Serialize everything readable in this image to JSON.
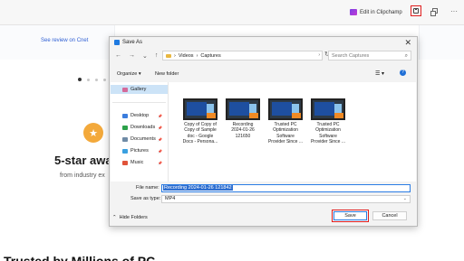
{
  "toolbar": {
    "edit_in_clipchamp": "Edit in Clipchamp",
    "more": "···"
  },
  "page": {
    "review_link": "See review on Cnet",
    "award_heading": "5-star awa",
    "award_sub": "from industry ex",
    "bottom_heading": "Trusted by Millions of PC"
  },
  "dialog": {
    "title": "Save As",
    "close": "✕",
    "nav": {
      "back": "←",
      "forward": "→",
      "down": "⌄",
      "up": "↑"
    },
    "address": {
      "path_1": "Videos",
      "sep": "›",
      "path_2": "Captures",
      "chev": "›"
    },
    "refresh": "↻",
    "search_placeholder": "Search Captures",
    "organize": "Organize ▾",
    "new_folder": "New folder",
    "view": "☰ ▾",
    "help": "?",
    "nav_items": [
      {
        "label": "Gallery",
        "icon": "gallery-icon",
        "color": "#d46a9a"
      },
      {
        "label": "Desktop",
        "icon": "desktop-icon",
        "color": "#3b7ddd"
      },
      {
        "label": "Downloads",
        "icon": "downloads-icon",
        "color": "#2ca14a"
      },
      {
        "label": "Documents",
        "icon": "documents-icon",
        "color": "#6f8ba6"
      },
      {
        "label": "Pictures",
        "icon": "pictures-icon",
        "color": "#3aa0e0"
      },
      {
        "label": "Music",
        "icon": "music-icon",
        "color": "#e0533a"
      }
    ],
    "files": [
      {
        "label": "Copy of Copy of\nCopy of Sample\ndoc - Google\nDocs - Persona..."
      },
      {
        "label": "Recording\n2024-01-26\n121650"
      },
      {
        "label": "Trusted PC\nOptimization\nSoftware\nProvider Since ..."
      },
      {
        "label": "Trusted PC\nOptimization\nSoftware\nProvider Since ..."
      }
    ],
    "file_name_label": "File name:",
    "file_name_value": "Recording 2024-01-26 121842",
    "save_as_type_label": "Save as type:",
    "save_as_type_value": "MP4",
    "hide_folders": "Hide Folders",
    "save": "Save",
    "cancel": "Cancel"
  }
}
